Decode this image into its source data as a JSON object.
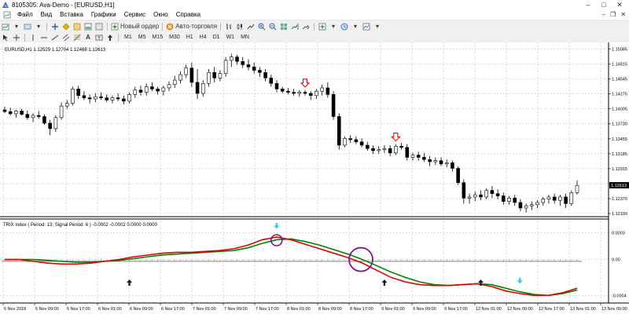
{
  "window": {
    "title": "8105305: Ava-Demo - [EURUSD,H1]"
  },
  "menu": [
    "Файл",
    "Вид",
    "Вставка",
    "Графики",
    "Сервис",
    "Окно",
    "Справка"
  ],
  "toolbar": {
    "new_order": "Новый ордер",
    "auto_trading": "Авто-торговля",
    "timeframes": [
      "M1",
      "M5",
      "M15",
      "M30",
      "H1",
      "H4",
      "D1",
      "W1",
      "MN"
    ],
    "text_tool": "A"
  },
  "main_chart": {
    "info": "EURUSD,H1  1.12529 1.12704 1.12468 1.12613",
    "price_labels": [
      "1.15085",
      "1.14815",
      "1.14545",
      "1.14275",
      "1.14005",
      "1.13730",
      "1.13455",
      "1.13185",
      "1.12915",
      "1.12640",
      "1.12370",
      "1.12100"
    ],
    "current_price": "1.12613"
  },
  "indicator": {
    "info": "TRIX index  ( Period: 13; Signal Period: 6 )  -0.0002 -0.0002 0.0000 0.0000",
    "labels": [
      "0.0003",
      "0.00",
      "-0.0004"
    ]
  },
  "time_labels": [
    "5 Nov 2018",
    "5 Nov 09:00",
    "5 Nov 17:00",
    "6 Nov 01:00",
    "6 Nov 09:00",
    "6 Nov 17:00",
    "7 Nov 01:00",
    "7 Nov 09:00",
    "7 Nov 17:00",
    "8 Nov 01:00",
    "8 Nov 09:00",
    "8 Nov 17:00",
    "9 Nov 01:00",
    "9 Nov 09:00",
    "9 Nov 17:00",
    "12 Nov 01:00",
    "12 Nov 09:00",
    "12 Nov 17:00",
    "13 Nov 01:00",
    "13 Nov 09:00"
  ],
  "colors": {
    "trix": "#e00000",
    "signal": "#008000",
    "histogram": "#9a9a9a",
    "up_arrow": "#1a1a1a",
    "down_arrow": "#e00000",
    "cyan_arrow": "#33ccee",
    "circle": "#7a1a8c",
    "grid": "#c8c8c8"
  },
  "chart_data": {
    "type": "candlestick",
    "symbol": "EURUSD",
    "timeframe": "H1",
    "ylim": [
      1.121,
      1.1512
    ],
    "candles": [
      [
        1.1398,
        1.1404,
        1.1392,
        1.1395
      ],
      [
        1.1395,
        1.1402,
        1.1388,
        1.1391
      ],
      [
        1.1391,
        1.1398,
        1.1384,
        1.1396
      ],
      [
        1.1396,
        1.14,
        1.1388,
        1.139
      ],
      [
        1.139,
        1.1397,
        1.138,
        1.1384
      ],
      [
        1.1384,
        1.1392,
        1.1376,
        1.1388
      ],
      [
        1.1388,
        1.1396,
        1.1382,
        1.1386
      ],
      [
        1.1386,
        1.139,
        1.1371,
        1.1374
      ],
      [
        1.1374,
        1.138,
        1.1352,
        1.1364
      ],
      [
        1.1364,
        1.1388,
        1.1358,
        1.1384
      ],
      [
        1.1384,
        1.1412,
        1.138,
        1.1405
      ],
      [
        1.1405,
        1.1416,
        1.14,
        1.141
      ],
      [
        1.141,
        1.144,
        1.1406,
        1.1436
      ],
      [
        1.1436,
        1.1442,
        1.1418,
        1.1424
      ],
      [
        1.1424,
        1.1432,
        1.1416,
        1.142
      ],
      [
        1.142,
        1.1426,
        1.141,
        1.1418
      ],
      [
        1.1418,
        1.1428,
        1.1412,
        1.1422
      ],
      [
        1.1422,
        1.143,
        1.1416,
        1.142
      ],
      [
        1.142,
        1.1426,
        1.1412,
        1.1416
      ],
      [
        1.1416,
        1.1424,
        1.141,
        1.142
      ],
      [
        1.142,
        1.1428,
        1.1414,
        1.1418
      ],
      [
        1.1418,
        1.1424,
        1.1408,
        1.1414
      ],
      [
        1.1414,
        1.143,
        1.141,
        1.1426
      ],
      [
        1.1426,
        1.144,
        1.142,
        1.1434
      ],
      [
        1.1434,
        1.1442,
        1.1424,
        1.143
      ],
      [
        1.143,
        1.1446,
        1.1424,
        1.144
      ],
      [
        1.144,
        1.1448,
        1.1432,
        1.1436
      ],
      [
        1.1436,
        1.144,
        1.1426,
        1.1432
      ],
      [
        1.1432,
        1.1442,
        1.1424,
        1.1438
      ],
      [
        1.1438,
        1.145,
        1.1432,
        1.1444
      ],
      [
        1.1444,
        1.146,
        1.1438,
        1.1452
      ],
      [
        1.1452,
        1.1468,
        1.1446,
        1.1462
      ],
      [
        1.1462,
        1.148,
        1.1456,
        1.1474
      ],
      [
        1.1474,
        1.1484,
        1.144,
        1.1448
      ],
      [
        1.1448,
        1.1472,
        1.1418,
        1.1428
      ],
      [
        1.1428,
        1.1452,
        1.1422,
        1.1446
      ],
      [
        1.1446,
        1.1472,
        1.144,
        1.1466
      ],
      [
        1.1466,
        1.1476,
        1.1448,
        1.1456
      ],
      [
        1.1456,
        1.147,
        1.145,
        1.1464
      ],
      [
        1.1464,
        1.1494,
        1.1458,
        1.1488
      ],
      [
        1.1488,
        1.15,
        1.1476,
        1.1494
      ],
      [
        1.1494,
        1.1498,
        1.148,
        1.1486
      ],
      [
        1.1486,
        1.1494,
        1.1474,
        1.148
      ],
      [
        1.148,
        1.149,
        1.147,
        1.1476
      ],
      [
        1.1476,
        1.1484,
        1.1464,
        1.147
      ],
      [
        1.147,
        1.1476,
        1.1458,
        1.1466
      ],
      [
        1.1466,
        1.1472,
        1.145,
        1.1456
      ],
      [
        1.1456,
        1.1462,
        1.144,
        1.1446
      ],
      [
        1.1446,
        1.1452,
        1.143,
        1.1436
      ],
      [
        1.1436,
        1.144,
        1.1428,
        1.1432
      ],
      [
        1.1432,
        1.1438,
        1.1426,
        1.143
      ],
      [
        1.143,
        1.1436,
        1.1424,
        1.1428
      ],
      [
        1.1428,
        1.1434,
        1.1422,
        1.143
      ],
      [
        1.143,
        1.1434,
        1.1424,
        1.1428
      ],
      [
        1.1428,
        1.1432,
        1.1416,
        1.1424
      ],
      [
        1.1424,
        1.1436,
        1.1418,
        1.1432
      ],
      [
        1.1432,
        1.1444,
        1.1424,
        1.1438
      ],
      [
        1.1438,
        1.1448,
        1.142,
        1.1426
      ],
      [
        1.1426,
        1.1432,
        1.138,
        1.1386
      ],
      [
        1.1386,
        1.1392,
        1.1326,
        1.1334
      ],
      [
        1.1334,
        1.135,
        1.133,
        1.1346
      ],
      [
        1.1346,
        1.1352,
        1.1338,
        1.1344
      ],
      [
        1.1344,
        1.135,
        1.1336,
        1.134
      ],
      [
        1.134,
        1.1346,
        1.133,
        1.1334
      ],
      [
        1.1334,
        1.134,
        1.1324,
        1.1328
      ],
      [
        1.1328,
        1.1334,
        1.1318,
        1.1324
      ],
      [
        1.1324,
        1.1332,
        1.1318,
        1.1326
      ],
      [
        1.1326,
        1.1334,
        1.132,
        1.1328
      ],
      [
        1.1328,
        1.1334,
        1.1314,
        1.132
      ],
      [
        1.132,
        1.1336,
        1.1316,
        1.1332
      ],
      [
        1.1332,
        1.1338,
        1.1326,
        1.133
      ],
      [
        1.133,
        1.1336,
        1.1306,
        1.1312
      ],
      [
        1.1312,
        1.132,
        1.1306,
        1.1316
      ],
      [
        1.1316,
        1.1322,
        1.1306,
        1.1312
      ],
      [
        1.1312,
        1.132,
        1.1304,
        1.1308
      ],
      [
        1.1308,
        1.1314,
        1.1296,
        1.1304
      ],
      [
        1.1304,
        1.1312,
        1.1298,
        1.1306
      ],
      [
        1.1306,
        1.1312,
        1.1296,
        1.13
      ],
      [
        1.13,
        1.1308,
        1.1294,
        1.1302
      ],
      [
        1.1302,
        1.1306,
        1.1286,
        1.1292
      ],
      [
        1.1292,
        1.1296,
        1.1262,
        1.1266
      ],
      [
        1.1266,
        1.1272,
        1.1228,
        1.1238
      ],
      [
        1.1238,
        1.1246,
        1.1228,
        1.124
      ],
      [
        1.124,
        1.125,
        1.1232,
        1.1244
      ],
      [
        1.1244,
        1.1252,
        1.1234,
        1.124
      ],
      [
        1.124,
        1.1256,
        1.1236,
        1.1252
      ],
      [
        1.1252,
        1.126,
        1.1238,
        1.1246
      ],
      [
        1.1246,
        1.1254,
        1.1236,
        1.1242
      ],
      [
        1.1242,
        1.1248,
        1.1226,
        1.1232
      ],
      [
        1.1232,
        1.1242,
        1.1226,
        1.1238
      ],
      [
        1.1238,
        1.1244,
        1.1224,
        1.123
      ],
      [
        1.123,
        1.1236,
        1.1214,
        1.122
      ],
      [
        1.122,
        1.1228,
        1.1212,
        1.1224
      ],
      [
        1.1224,
        1.1232,
        1.1216,
        1.1226
      ],
      [
        1.1226,
        1.1234,
        1.122,
        1.123
      ],
      [
        1.123,
        1.124,
        1.1224,
        1.1236
      ],
      [
        1.1236,
        1.1244,
        1.1228,
        1.124
      ],
      [
        1.124,
        1.1246,
        1.1228,
        1.1234
      ],
      [
        1.1234,
        1.1244,
        1.1224,
        1.124
      ],
      [
        1.124,
        1.1246,
        1.122,
        1.1228
      ],
      [
        1.1228,
        1.1252,
        1.1224,
        1.1248
      ],
      [
        1.1248,
        1.127,
        1.1244,
        1.1261
      ]
    ],
    "trix": [
      0.0,
      0.0,
      -2e-05,
      -4e-05,
      -5e-05,
      -5e-05,
      -4e-05,
      -2e-05,
      0.0,
      3e-05,
      5e-05,
      7e-05,
      8e-05,
      8e-05,
      9e-05,
      0.0001,
      0.00012,
      0.00016,
      0.00022,
      0.00025,
      0.00022,
      0.00017,
      0.00012,
      7e-05,
      2e-05,
      -4e-05,
      -0.00012,
      -0.0002,
      -0.00025,
      -0.00028,
      -0.00029,
      -0.00029,
      -0.00028,
      -0.00027,
      -0.0003,
      -0.00035,
      -0.00038,
      -0.0004,
      -0.0004,
      -0.00037,
      -0.00032
    ],
    "signal": [
      0.0,
      0.0,
      0.0,
      -1e-05,
      -2e-05,
      -3e-05,
      -3e-05,
      -2e-05,
      -1e-05,
      1e-05,
      3e-05,
      5e-05,
      6e-05,
      7e-05,
      8e-05,
      9e-05,
      0.0001,
      0.00013,
      0.00018,
      0.00022,
      0.00023,
      0.0002,
      0.00016,
      0.00011,
      6e-05,
      0.0,
      -7e-05,
      -0.00014,
      -0.0002,
      -0.00025,
      -0.00028,
      -0.00029,
      -0.00028,
      -0.00027,
      -0.00028,
      -0.00032,
      -0.00036,
      -0.00039,
      -0.0004,
      -0.00038,
      -0.00034
    ],
    "histogram_level": -2e-05,
    "indicator_ylim": [
      -0.00045,
      0.00032
    ],
    "down_arrow_candles": [
      53,
      69
    ],
    "up_arrow_candles": [
      22,
      67,
      84
    ]
  }
}
